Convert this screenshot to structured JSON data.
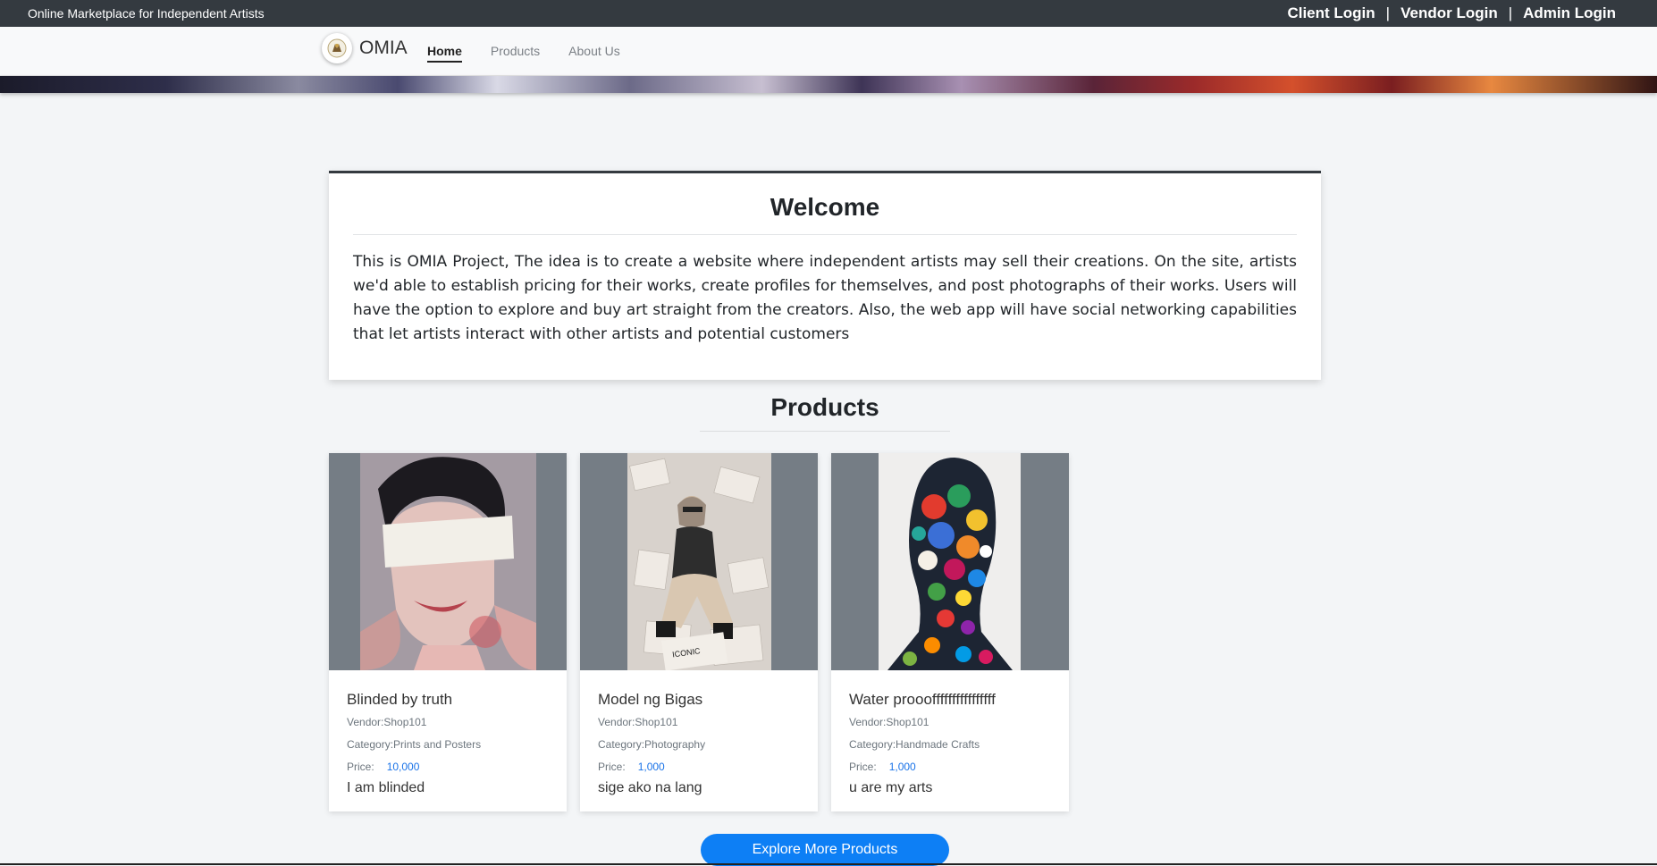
{
  "topbar": {
    "site_title": "Online Marketplace for Independent Artists",
    "client_login": "Client Login",
    "vendor_login": "Vendor Login",
    "admin_login": "Admin Login",
    "separator": "|"
  },
  "navbar": {
    "brand": "OMIA",
    "links": [
      "Home",
      "Products",
      "About Us"
    ],
    "active": "Home"
  },
  "welcome": {
    "title": "Welcome",
    "body": "This is OMIA Project, The idea is to create a website where independent artists may sell their creations. On the site, artists we'd able to establish pricing for their works, create profiles for themselves, and post photographs of their works. Users will have the option to explore and buy art straight from the creators. Also, the web app will have social networking capabilities that let artists interact with other artists and potential customers"
  },
  "products": {
    "title": "Products",
    "price_label": "Price:",
    "items": [
      {
        "title": "Blinded by truth",
        "vendor": "Vendor:Shop101",
        "category": "Category:Prints and Posters",
        "price": "10,000",
        "description": "I am blinded"
      },
      {
        "title": "Model ng Bigas",
        "vendor": "Vendor:Shop101",
        "category": "Category:Photography",
        "price": "1,000",
        "description": "sige ako na lang"
      },
      {
        "title": "Water proooffffffffffffffff",
        "vendor": "Vendor:Shop101",
        "category": "Category:Handmade Crafts",
        "price": "1,000",
        "description": "u are my arts"
      }
    ],
    "explore_button": "Explore More Products"
  },
  "colors": {
    "topbar": "#343a40",
    "accent": "#0d7ff5",
    "price": "#1a73e8"
  }
}
